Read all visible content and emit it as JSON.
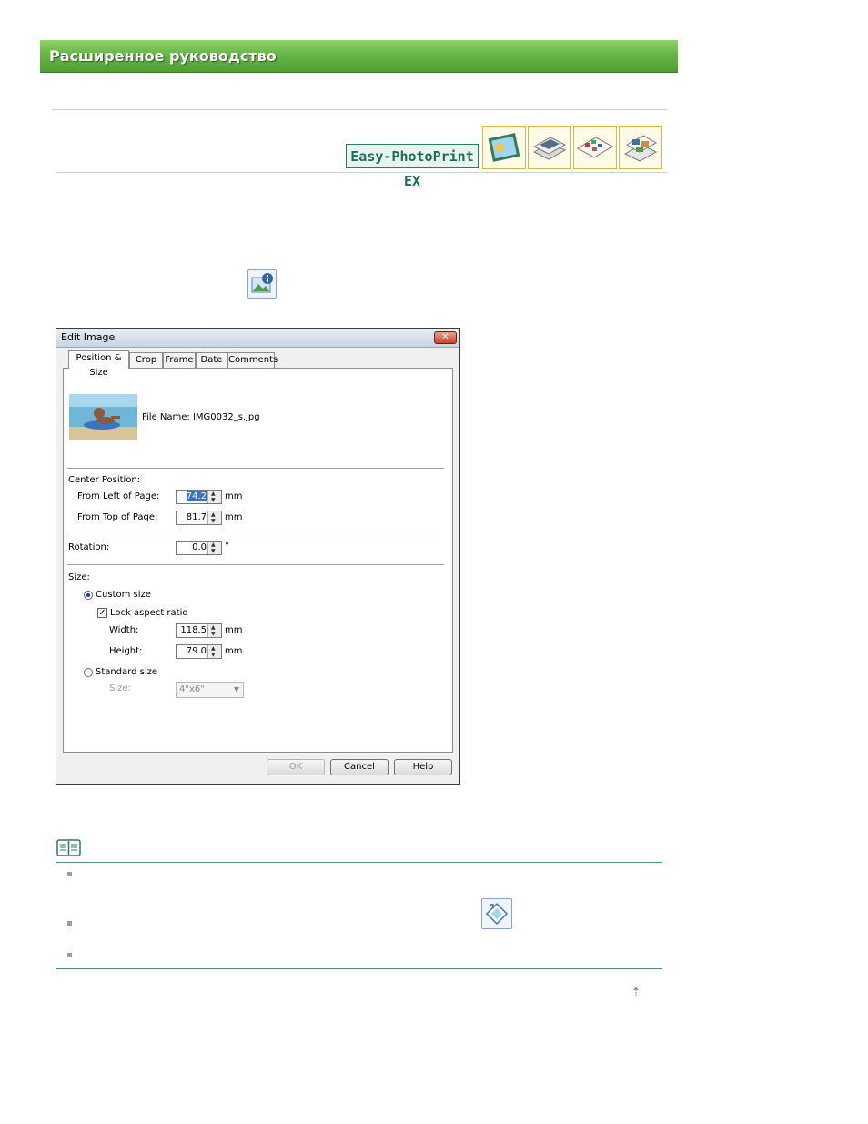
{
  "header": {
    "title": "Расширенное руководство"
  },
  "brand": {
    "product_label": "Easy-PhotoPrint EX",
    "accent_color": "#66b646"
  },
  "thumbnails": [
    {
      "icon": "album-icon"
    },
    {
      "icon": "stacked-photos-icon"
    },
    {
      "icon": "calendar-layout-icon"
    },
    {
      "icon": "sticker-layout-icon"
    }
  ],
  "dialog": {
    "title": "Edit Image",
    "close_label": "✕",
    "tabs": [
      {
        "label": "Position & Size",
        "active": true
      },
      {
        "label": "Crop"
      },
      {
        "label": "Frame"
      },
      {
        "label": "Date"
      },
      {
        "label": "Comments"
      }
    ],
    "file_name_label": "File Name: IMG0032_s.jpg",
    "center_position": {
      "heading": "Center Position:",
      "from_left_label": "From Left of Page:",
      "from_left_value": "74.2",
      "from_top_label": "From Top of Page:",
      "from_top_value": "81.7",
      "unit": "mm"
    },
    "rotation": {
      "label": "Rotation:",
      "value": "0.0",
      "unit": "°"
    },
    "size": {
      "heading": "Size:",
      "custom_size_label": "Custom size",
      "custom_size_selected": true,
      "lock_aspect_label": "Lock aspect ratio",
      "lock_aspect_checked": true,
      "width_label": "Width:",
      "width_value": "118.5",
      "height_label": "Height:",
      "height_value": "79.0",
      "unit": "mm",
      "standard_size_label": "Standard size",
      "standard_size_selected": false,
      "standard_size_select_label": "Size:",
      "standard_size_value": "4\"x6\""
    },
    "buttons": {
      "ok": "OK",
      "cancel": "Cancel",
      "help": "Help"
    }
  },
  "note": {
    "icon": "book-icon"
  },
  "footer": {
    "top_link_glyph": "⇡"
  }
}
